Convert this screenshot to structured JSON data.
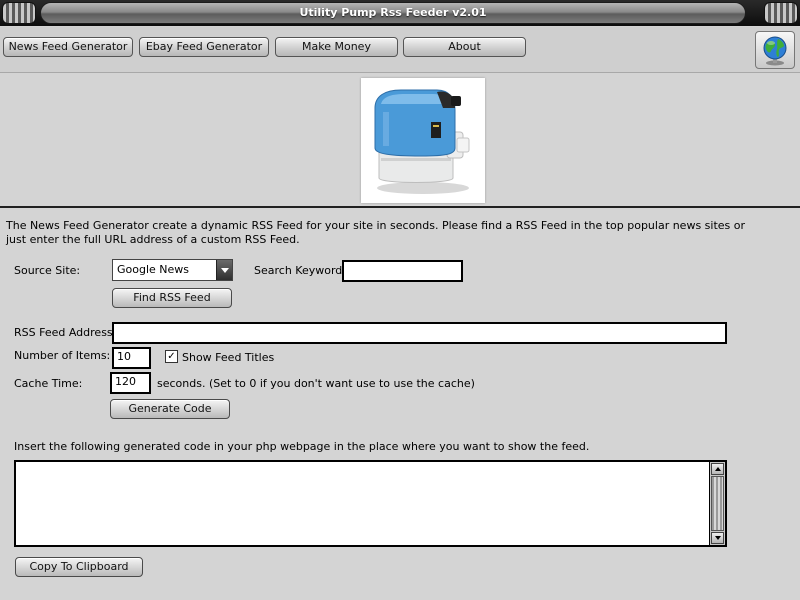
{
  "window": {
    "title": "Utility Pump Rss Feeder v2.01"
  },
  "menu": {
    "items": [
      {
        "label": "News Feed Generator"
      },
      {
        "label": "Ebay Feed Generator"
      },
      {
        "label": "Make Money"
      },
      {
        "label": "About"
      }
    ],
    "globe_icon": "globe-icon"
  },
  "header": {
    "image": "utility-pump-product-photo"
  },
  "main": {
    "description": "The News Feed Generator create a dynamic RSS Feed for your site in seconds. Please find a RSS Feed in the top popular news sites or just enter the full URL address of a custom RSS Feed.",
    "source_site_label": "Source Site:",
    "source_site_value": "Google News",
    "search_keyword_label": "Search Keyword:",
    "search_keyword_value": "",
    "find_button": "Find RSS Feed",
    "rss_address_label": "RSS Feed Address:",
    "rss_address_value": "",
    "number_items_label": "Number of Items:",
    "number_items_value": "10",
    "show_titles_label": "Show Feed Titles",
    "show_titles_checked": true,
    "cache_time_label": "Cache Time:",
    "cache_time_value": "120",
    "cache_hint": "seconds. (Set to 0 if you don't want use to use the cache)",
    "generate_button": "Generate Code",
    "insert_label": "Insert the following generated code in your php webpage in the place where you want to show the feed.",
    "code_value": "",
    "copy_button": "Copy To Clipboard"
  },
  "colors": {
    "background": "#d4d4d4",
    "titlebar": "#0d0d0d",
    "pump_blue": "#4a9ad8"
  }
}
